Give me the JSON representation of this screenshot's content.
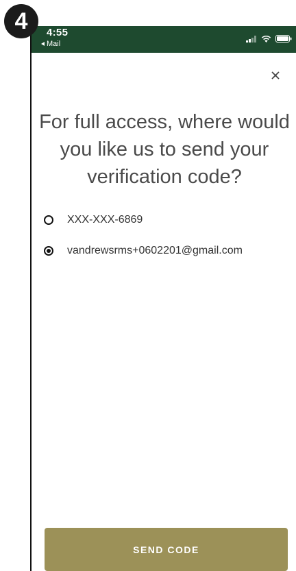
{
  "step_badge": "4",
  "status_bar": {
    "time": "4:55",
    "back_app": "Mail",
    "color": "#1e4a2f"
  },
  "dialog": {
    "close_icon": "close-icon",
    "heading": "For full access, where would you like us to send your verification code?",
    "options": [
      {
        "label": "XXX-XXX-6869",
        "selected": false
      },
      {
        "label": "vandrewsrms+0602201@gmail.com",
        "selected": true
      }
    ],
    "send_button_label": "SEND CODE",
    "button_color": "#9c9158"
  }
}
